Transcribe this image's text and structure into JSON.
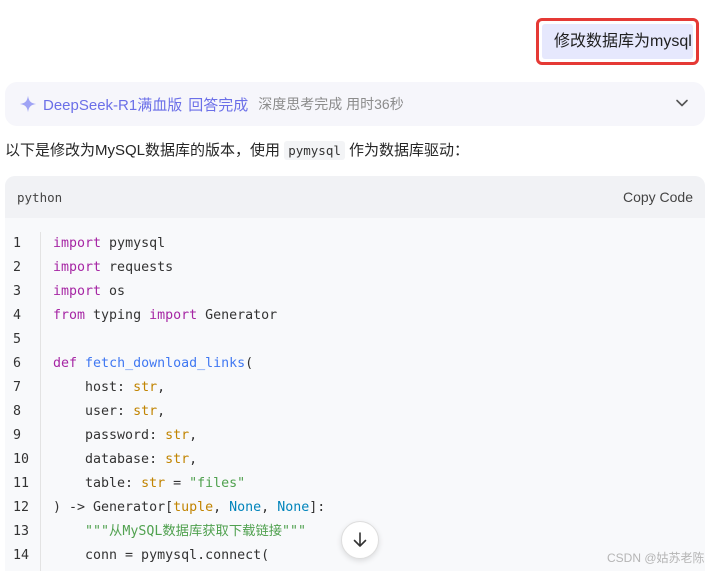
{
  "user_message": {
    "text": "修改数据库为mysql"
  },
  "thinking": {
    "model_name": "DeepSeek-R1满血版",
    "status": "回答完成",
    "time_text": "深度思考完成 用时36秒",
    "icons": {
      "sparkle": "sparkle-icon",
      "expand": "chevron-down-icon"
    }
  },
  "answer": {
    "intro_before": "以下是修改为MySQL数据库的版本，使用 ",
    "intro_code": "pymysql",
    "intro_after": " 作为数据库驱动："
  },
  "code_block": {
    "language": "python",
    "copy_label": "Copy Code",
    "lines": [
      {
        "n": "1",
        "tokens": [
          {
            "t": "import",
            "c": "kw"
          },
          {
            "t": " pymysql",
            "c": ""
          }
        ]
      },
      {
        "n": "2",
        "tokens": [
          {
            "t": "import",
            "c": "kw"
          },
          {
            "t": " requests",
            "c": ""
          }
        ]
      },
      {
        "n": "3",
        "tokens": [
          {
            "t": "import",
            "c": "kw"
          },
          {
            "t": " os",
            "c": ""
          }
        ]
      },
      {
        "n": "4",
        "tokens": [
          {
            "t": "from",
            "c": "kw"
          },
          {
            "t": " typing ",
            "c": ""
          },
          {
            "t": "import",
            "c": "kw"
          },
          {
            "t": " Generator",
            "c": ""
          }
        ]
      },
      {
        "n": "5",
        "tokens": []
      },
      {
        "n": "6",
        "tokens": [
          {
            "t": "def",
            "c": "kw"
          },
          {
            "t": " ",
            "c": ""
          },
          {
            "t": "fetch_download_links",
            "c": "fn"
          },
          {
            "t": "(",
            "c": ""
          }
        ]
      },
      {
        "n": "7",
        "tokens": [
          {
            "t": "    host: ",
            "c": ""
          },
          {
            "t": "str",
            "c": "bi"
          },
          {
            "t": ",",
            "c": ""
          }
        ]
      },
      {
        "n": "8",
        "tokens": [
          {
            "t": "    user: ",
            "c": ""
          },
          {
            "t": "str",
            "c": "bi"
          },
          {
            "t": ",",
            "c": ""
          }
        ]
      },
      {
        "n": "9",
        "tokens": [
          {
            "t": "    password: ",
            "c": ""
          },
          {
            "t": "str",
            "c": "bi"
          },
          {
            "t": ",",
            "c": ""
          }
        ]
      },
      {
        "n": "10",
        "tokens": [
          {
            "t": "    database: ",
            "c": ""
          },
          {
            "t": "str",
            "c": "bi"
          },
          {
            "t": ",",
            "c": ""
          }
        ]
      },
      {
        "n": "11",
        "tokens": [
          {
            "t": "    table: ",
            "c": ""
          },
          {
            "t": "str",
            "c": "bi"
          },
          {
            "t": " = ",
            "c": ""
          },
          {
            "t": "\"files\"",
            "c": "str"
          }
        ]
      },
      {
        "n": "12",
        "tokens": [
          {
            "t": ") -> Generator[",
            "c": ""
          },
          {
            "t": "tuple",
            "c": "bi"
          },
          {
            "t": ", ",
            "c": ""
          },
          {
            "t": "None",
            "c": "cn"
          },
          {
            "t": ", ",
            "c": ""
          },
          {
            "t": "None",
            "c": "cn"
          },
          {
            "t": "]:",
            "c": ""
          }
        ]
      },
      {
        "n": "13",
        "tokens": [
          {
            "t": "    \"\"\"从MySQL数据库获取下载链接\"\"\"",
            "c": "str"
          }
        ]
      },
      {
        "n": "14",
        "tokens": [
          {
            "t": "    conn = pymysql.connect(",
            "c": ""
          }
        ]
      }
    ]
  },
  "scroll_button": {
    "icon": "arrow-down-icon"
  },
  "watermark": "CSDN @姑苏老陈",
  "colors": {
    "accent": "#6b6fe8",
    "highlight_border": "#e53935",
    "user_bubble_bg": "#e6e8fd"
  }
}
